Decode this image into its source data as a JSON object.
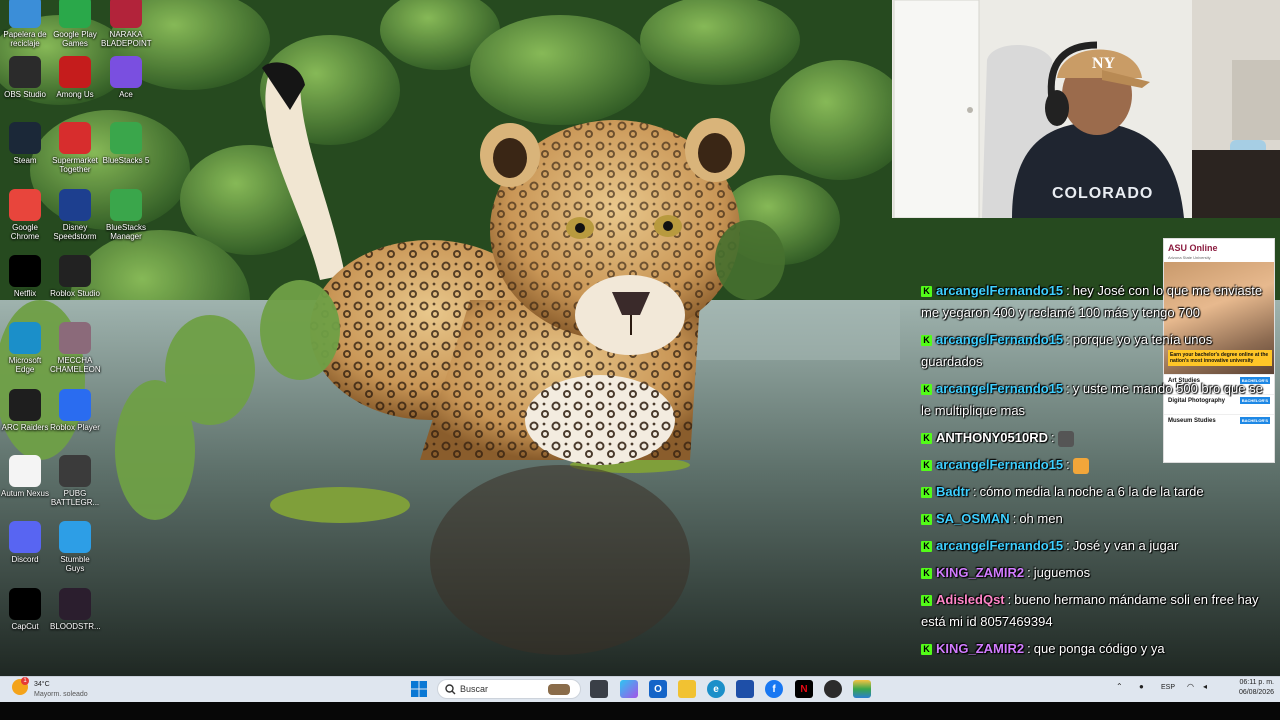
{
  "desktop_icons": [
    {
      "label": "Papelera de reciclaje",
      "icon": "recycle-bin-icon",
      "color": "#3b8ed8"
    },
    {
      "label": "Google Play Games",
      "icon": "google-play-games-icon",
      "color": "#2aa84a"
    },
    {
      "label": "NARAKA BLADEPOINT",
      "icon": "naraka-icon",
      "color": "#b2233a"
    },
    {
      "label": "OBS Studio",
      "icon": "obs-icon",
      "color": "#2b2b2b"
    },
    {
      "label": "Among Us",
      "icon": "among-us-icon",
      "color": "#c51c1c"
    },
    {
      "label": "Ace",
      "icon": "ace-icon",
      "color": "#7a4fe0"
    },
    {
      "label": "Steam",
      "icon": "steam-icon",
      "color": "#1b2838"
    },
    {
      "label": "Supermarket Together",
      "icon": "supermarket-together-icon",
      "color": "#d72d2d"
    },
    {
      "label": "BlueStacks 5",
      "icon": "bluestacks-icon",
      "color": "#3aa64b"
    },
    {
      "label": "Google Chrome",
      "icon": "chrome-icon",
      "color": "#e8453c"
    },
    {
      "label": "Disney Speedstorm",
      "icon": "disney-speedstorm-icon",
      "color": "#1d3f8f"
    },
    {
      "label": "BlueStacks Manager",
      "icon": "bluestacks-manager-icon",
      "color": "#3aa64b"
    },
    {
      "label": "Netflix",
      "icon": "netflix-icon",
      "color": "#000000"
    },
    {
      "label": "Roblox Studio",
      "icon": "roblox-studio-icon",
      "color": "#222222"
    },
    {
      "label": "Microsoft Edge",
      "icon": "edge-icon",
      "color": "#1b8fc9"
    },
    {
      "label": "MECCHA CHAMELEON",
      "icon": "meccha-chameleon-icon",
      "color": "#8b6a7a"
    },
    {
      "label": "ARC Raiders",
      "icon": "arc-raiders-icon",
      "color": "#1e1e1e"
    },
    {
      "label": "Roblox Player",
      "icon": "roblox-player-icon",
      "color": "#2a6cf0"
    },
    {
      "label": "Autum Nexus",
      "icon": "autum-nexus-icon",
      "color": "#f4f4f4"
    },
    {
      "label": "PUBG BATTLEGR...",
      "icon": "pubg-icon",
      "color": "#3b3b3b"
    },
    {
      "label": "Discord",
      "icon": "discord-icon",
      "color": "#5865f2"
    },
    {
      "label": "Stumble Guys",
      "icon": "stumble-guys-icon",
      "color": "#2d9ee6"
    },
    {
      "label": "CapCut",
      "icon": "capcut-icon",
      "color": "#000000"
    },
    {
      "label": "BLOODSTR...",
      "icon": "bloodstrike-icon",
      "color": "#2b1e2e"
    }
  ],
  "ad": {
    "brand": "ASU Online",
    "subtitle": "Arizona State University",
    "banner": "Earn your bachelor's degree online at the nation's most innovative university",
    "rows": [
      {
        "label": "Art Studies",
        "tag": "BACHELOR'S"
      },
      {
        "label": "Digital Photography",
        "tag": "BACHELOR'S"
      },
      {
        "label": "Museum Studies",
        "tag": "BACHELOR'S"
      }
    ]
  },
  "chat": {
    "accent": "#53fc18",
    "messages": [
      {
        "user": "arcangelFernando15",
        "color": "#3fd0ff",
        "text": "hey José con lo que me enviaste me yegaron 400 y reclamé 100 más y tengo 700"
      },
      {
        "user": "arcangelFernando15",
        "color": "#3fd0ff",
        "text": "porque yo ya tenía unos guardados"
      },
      {
        "user": "arcangelFernando15",
        "color": "#3fd0ff",
        "text": "y uste me mando 500 bro que se le multiplique mas"
      },
      {
        "user": "ANTHONY0510RD",
        "color": "#ffffff",
        "text": "",
        "emote": "spider-emote"
      },
      {
        "user": "arcangelFernando15",
        "color": "#3fd0ff",
        "text": "",
        "emote": "smile-emote"
      },
      {
        "user": "Badtr",
        "color": "#3fd0ff",
        "text": "cómo media la noche a 6 la de la tarde"
      },
      {
        "user": "SA_OSMAN",
        "color": "#3fd0ff",
        "text": "oh men"
      },
      {
        "user": "arcangelFernando15",
        "color": "#3fd0ff",
        "text": "José y van a jugar"
      },
      {
        "user": "KING_ZAMIR2",
        "color": "#d27cff",
        "text": "juguemos"
      },
      {
        "user": "AdisledQst",
        "color": "#ff86c8",
        "text": "bueno hermano mándame soli en free hay está mi id 8057469394"
      },
      {
        "user": "KING_ZAMIR2",
        "color": "#d27cff",
        "text": "que ponga código y ya"
      }
    ]
  },
  "taskbar": {
    "weather_temp": "34°C",
    "weather_desc": "Mayorm. soleado",
    "search_placeholder": "Buscar",
    "language": "ESP",
    "time": "06:11 p. m.",
    "date": "06/08/2026"
  }
}
